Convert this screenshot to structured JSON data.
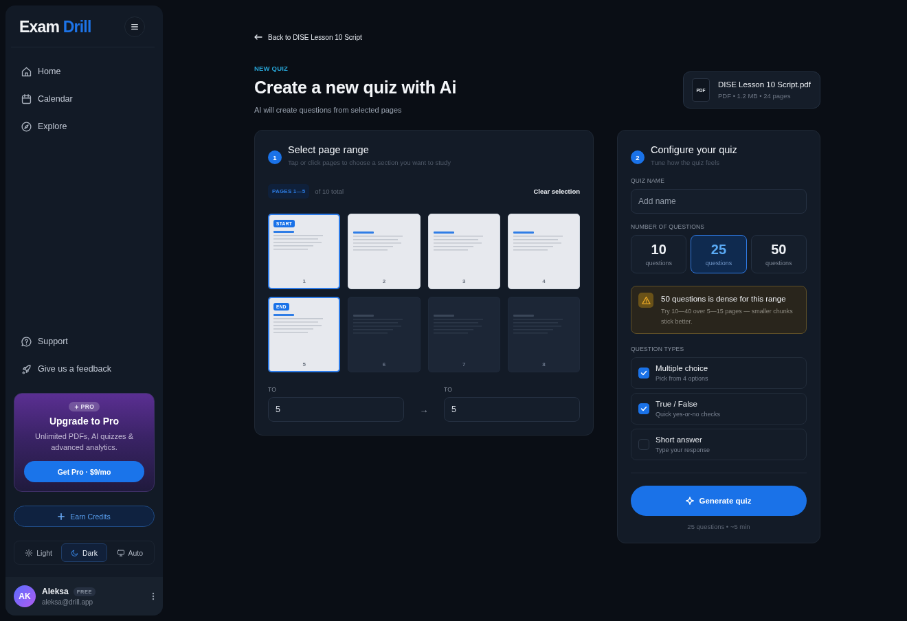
{
  "sidebar": {
    "logo": {
      "first": "Exam",
      "second": "Drill"
    },
    "nav": [
      {
        "label": "Home"
      },
      {
        "label": "Calendar"
      },
      {
        "label": "Explore"
      }
    ],
    "footer_nav": [
      {
        "label": "Support"
      },
      {
        "label": "Give us a feedback"
      }
    ],
    "promo": {
      "badge": "PRO",
      "title": "Upgrade to Pro",
      "text": "Unlimited PDFs, AI quizzes & advanced analytics.",
      "button": "Get Pro · $9/mo"
    },
    "earn_credits": "Earn Credits",
    "theme": [
      {
        "label": "Light",
        "selected": false
      },
      {
        "label": "Dark",
        "selected": true
      },
      {
        "label": "Auto",
        "selected": false
      }
    ],
    "user": {
      "initials": "AK",
      "name": "Aleksa",
      "plan": "FREE",
      "email": "aleksa@drill.app"
    }
  },
  "header": {
    "back_link": "Back to DISE Lesson 10 Script",
    "eyebrow": "NEW QUIZ",
    "title": "Create a new quiz with Ai",
    "subtitle": "AI will create questions from selected pages",
    "file": {
      "type": "PDF",
      "name": "DISE Lesson 10 Script.pdf",
      "meta": "PDF • 1.2 MB • 24 pages"
    }
  },
  "range_panel": {
    "step": "1",
    "title": "Select page range",
    "subtitle": "Tap or click pages to choose a section you want to study",
    "range_chip": "PAGES 1—5",
    "total": "of 10 total",
    "clear": "Clear selection",
    "pages": [
      {
        "number": "1",
        "in_range": true,
        "selected": true,
        "marker": "START"
      },
      {
        "number": "2",
        "in_range": true,
        "selected": false
      },
      {
        "number": "3",
        "in_range": true,
        "selected": false
      },
      {
        "number": "4",
        "in_range": true,
        "selected": false
      },
      {
        "number": "5",
        "in_range": true,
        "selected": true,
        "marker": "END"
      },
      {
        "number": "6",
        "in_range": false,
        "selected": false
      },
      {
        "number": "7",
        "in_range": false,
        "selected": false
      },
      {
        "number": "8",
        "in_range": false,
        "selected": false
      }
    ],
    "from": {
      "label": "TO",
      "value": "5"
    },
    "arrow": "→",
    "to": {
      "label": "TO",
      "value": "5"
    }
  },
  "config_panel": {
    "step": "2",
    "title": "Configure your quiz",
    "subtitle": "Tune how the quiz feels",
    "name_label": "QUIZ NAME",
    "name_placeholder": "Add name",
    "count_label": "NUMBER OF QUESTIONS",
    "counts": [
      {
        "value": "10",
        "unit": "questions",
        "selected": false
      },
      {
        "value": "25",
        "unit": "questions",
        "selected": true
      },
      {
        "value": "50",
        "unit": "questions",
        "selected": false
      }
    ],
    "warning": {
      "title": "50 questions is dense for this range",
      "text": "Try 10—40 over 5—15 pages — smaller chunks stick better."
    },
    "types_label": "QUESTION TYPES",
    "types": [
      {
        "title": "Multiple choice",
        "hint": "Pick from 4 options",
        "checked": true
      },
      {
        "title": "True / False",
        "hint": "Quick yes-or-no checks",
        "checked": true
      },
      {
        "title": "Short answer",
        "hint": "Type your response",
        "checked": false
      }
    ],
    "generate": "Generate quiz",
    "summary": "25 questions • ~5 min"
  }
}
